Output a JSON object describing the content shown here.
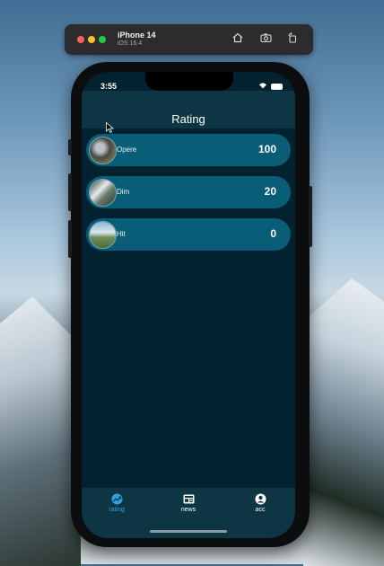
{
  "simulator": {
    "device_name": "iPhone 14",
    "os_version": "iOS 16.4"
  },
  "status_bar": {
    "time": "3:55"
  },
  "header": {
    "title": "Rating"
  },
  "rating_list": [
    {
      "name": "Opere",
      "score": "100"
    },
    {
      "name": "Dim",
      "score": "20"
    },
    {
      "name": "Hit",
      "score": "0"
    }
  ],
  "tabbar": {
    "tabs": [
      {
        "label": "rating",
        "icon": "trending-icon",
        "active": true
      },
      {
        "label": "news",
        "icon": "news-icon",
        "active": false
      },
      {
        "label": "acc",
        "icon": "account-icon",
        "active": false
      }
    ]
  },
  "colors": {
    "screen_bg": "#03222f",
    "row_bg": "#0a5d77",
    "active_tab": "#2fa0e6"
  }
}
